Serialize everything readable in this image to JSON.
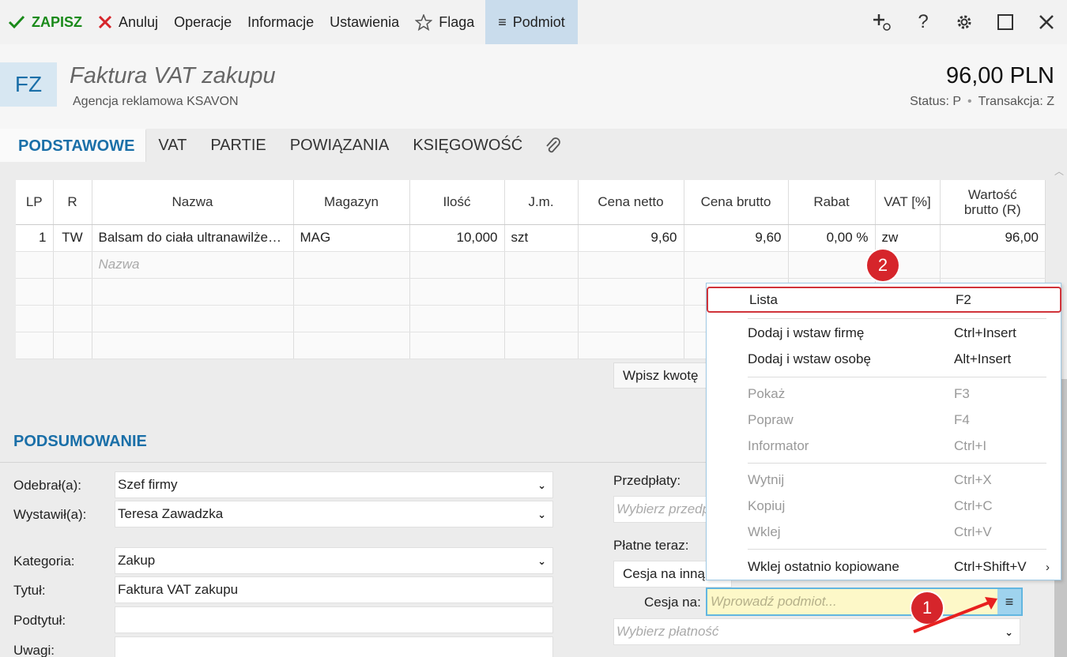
{
  "toolbar": {
    "save_label": "ZAPISZ",
    "cancel_label": "Anuluj",
    "operations_label": "Operacje",
    "info_label": "Informacje",
    "settings_label": "Ustawienia",
    "flag_label": "Flaga",
    "entity_label": "Podmiot",
    "help_label": "?"
  },
  "header": {
    "badge": "FZ",
    "title": "Faktura VAT zakupu",
    "subtitle": "Agencja reklamowa KSAVON",
    "amount": "96,00 PLN",
    "status_label": "Status:",
    "status_value": "P",
    "transaction_label": "Transakcja:",
    "transaction_value": "Z"
  },
  "tabs": [
    {
      "label": "PODSTAWOWE"
    },
    {
      "label": "VAT"
    },
    {
      "label": "PARTIE"
    },
    {
      "label": "POWIĄZANIA"
    },
    {
      "label": "KSIĘGOWOŚĆ"
    }
  ],
  "table": {
    "headers": [
      "LP",
      "R",
      "Nazwa",
      "Magazyn",
      "Ilość",
      "J.m.",
      "Cena netto",
      "Cena brutto",
      "Rabat",
      "VAT [%]",
      "Wartość",
      "brutto (R)"
    ],
    "rows": [
      {
        "lp": "1",
        "r": "TW",
        "nazwa": "Balsam do ciała ultranawilże…",
        "magazyn": "MAG",
        "ilosc": "10,000",
        "jm": "szt",
        "netto": "9,60",
        "brutto": "9,60",
        "rabat": "0,00 %",
        "vat": "zw",
        "wartosc": "96,00"
      }
    ],
    "new_row_placeholder": "Nazwa",
    "enter_amount_button": "Wpisz kwotę"
  },
  "summary": {
    "title": "PODSUMOWANIE",
    "received_label": "Odebrał(a):",
    "received_value": "Szef firmy",
    "issued_label": "Wystawił(a):",
    "issued_value": "Teresa Zawadzka",
    "category_label": "Kategoria:",
    "category_value": "Zakup",
    "title_label": "Tytuł:",
    "title_value": "Faktura VAT zakupu",
    "subtitle_label": "Podtytuł:",
    "notes_label": "Uwagi:",
    "prepayments_label": "Przedpłaty:",
    "prepayments_placeholder": "Wybierz przedpłatę",
    "paid_now_label": "Płatne teraz:",
    "paid_now_value": "Cesja na inną",
    "cession_label": "Cesja na:",
    "cession_placeholder": "Wprowadź podmiot...",
    "payment_placeholder": "Wybierz płatność"
  },
  "context_menu": {
    "items": [
      {
        "label": "Lista",
        "shortcut": "F2"
      },
      {
        "label": "Dodaj i wstaw firmę",
        "shortcut": "Ctrl+Insert"
      },
      {
        "label": "Dodaj i wstaw osobę",
        "shortcut": "Alt+Insert"
      },
      {
        "label": "Pokaż",
        "shortcut": "F3"
      },
      {
        "label": "Popraw",
        "shortcut": "F4"
      },
      {
        "label": "Informator",
        "shortcut": "Ctrl+I"
      },
      {
        "label": "Wytnij",
        "shortcut": "Ctrl+X"
      },
      {
        "label": "Kopiuj",
        "shortcut": "Ctrl+C"
      },
      {
        "label": "Wklej",
        "shortcut": "Ctrl+V"
      },
      {
        "label": "Wklej ostatnio kopiowane",
        "shortcut": "Ctrl+Shift+V"
      }
    ]
  },
  "annotations": {
    "badge_1": "1",
    "badge_2": "2"
  },
  "colors": {
    "accent": "#1a6fa8",
    "save_green": "#1a8a1a",
    "cancel_red": "#d6252b",
    "highlight_red": "#d0333a",
    "input_yellow": "#fdf8c8"
  }
}
